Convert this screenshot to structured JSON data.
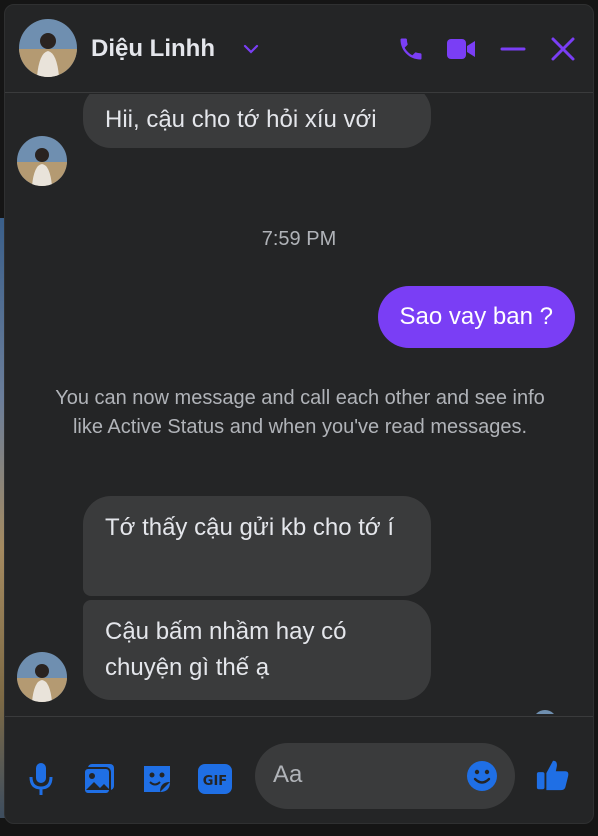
{
  "header": {
    "contact_name": "Diệu Linhh"
  },
  "messages": {
    "first_in": "Hii, cậu cho tớ hỏi xíu với",
    "timestamp": "7:59 PM",
    "out": "Sao vay ban ?",
    "notice": "You can now message and call each other and see info like Active Status and when you've read messages.",
    "second_in": "Tớ thấy cậu gửi kb cho tớ í",
    "third_in": "Cậu bấm nhầm hay có chuyện gì thế ạ"
  },
  "composer": {
    "placeholder": "Aa"
  },
  "colors": {
    "accent": "#7a3ef5",
    "icon_blue": "#1f6fe5",
    "bubble_in": "#3a3b3c",
    "background": "#242526"
  },
  "icons": {
    "header": [
      "phone-icon",
      "video-camera-icon",
      "minimize-icon",
      "close-icon"
    ],
    "composer": [
      "microphone-icon",
      "image-icon",
      "sticker-icon",
      "gif-icon",
      "emoji-icon",
      "thumbs-up-icon"
    ]
  }
}
